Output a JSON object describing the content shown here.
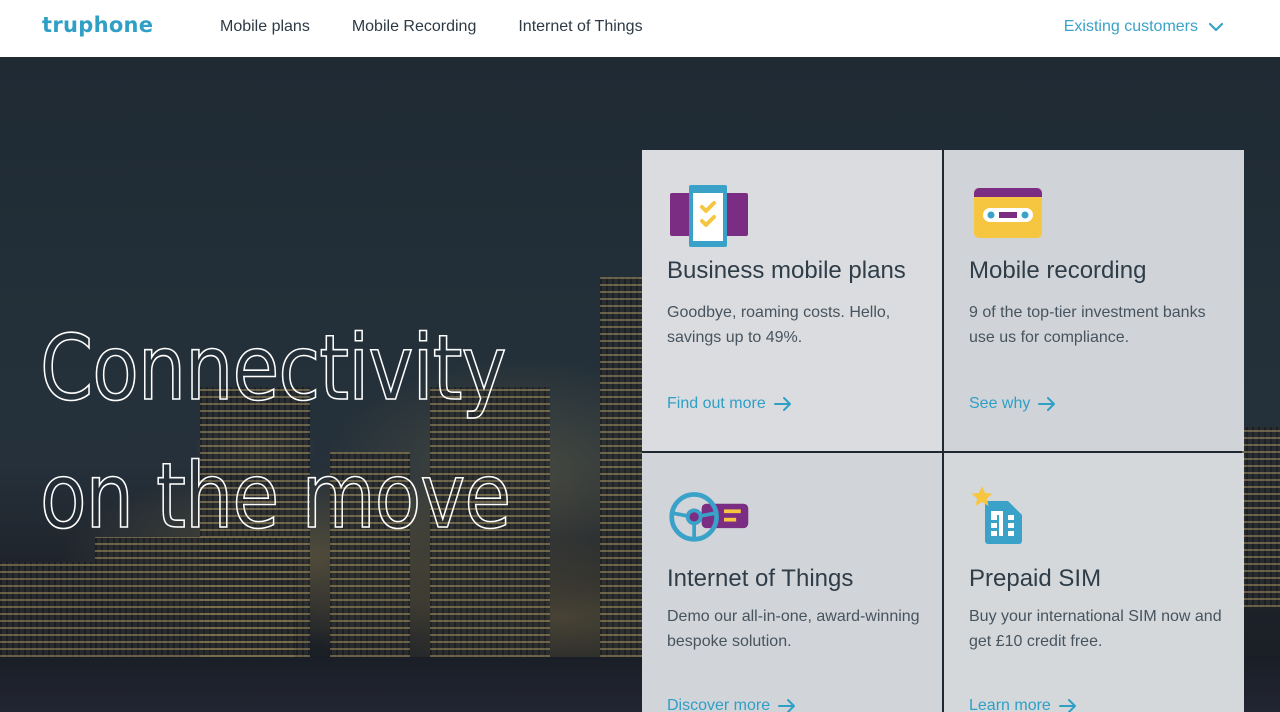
{
  "header": {
    "logo": "truphone",
    "nav": [
      {
        "label": "Mobile plans"
      },
      {
        "label": "Mobile Recording"
      },
      {
        "label": "Internet of Things"
      }
    ],
    "existing_customers": "Existing customers",
    "existing_icon": "chevron-down-icon"
  },
  "hero": {
    "title_line1": "Connectivity",
    "title_line2": "on the move"
  },
  "cards": [
    {
      "icon": "phone-checklist-icon",
      "title": "Business mobile plans",
      "desc": "Goodbye, roaming costs. Hello, savings up to 49%.",
      "link": "Find out more"
    },
    {
      "icon": "cassette-tape-icon",
      "title": "Mobile recording",
      "desc": "9 of the top-tier investment banks use us for compliance.",
      "link": "See why"
    },
    {
      "icon": "steering-wheel-icon",
      "title": "Internet of Things",
      "desc": "Demo our all-in-one, award-winning bespoke solution.",
      "link": "Discover more"
    },
    {
      "icon": "sim-card-star-icon",
      "title": "Prepaid SIM",
      "desc": "Buy your international SIM now and get £10 credit free.",
      "link": "Learn more"
    }
  ],
  "colors": {
    "brand": "#2f9fc6",
    "purple": "#7b2d83",
    "yellow": "#f7c641",
    "text_dark": "#2f3d48"
  }
}
